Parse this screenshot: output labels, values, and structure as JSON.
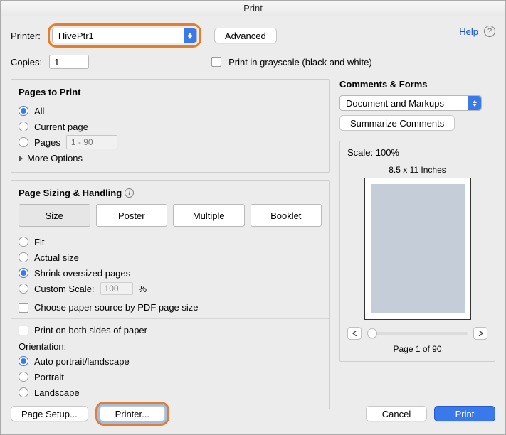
{
  "window": {
    "title": "Print"
  },
  "top": {
    "printer_label": "Printer:",
    "printer_value": "HivePtr1",
    "advanced": "Advanced",
    "help": "Help",
    "copies_label": "Copies:",
    "copies_value": "1",
    "grayscale_label": "Print in grayscale (black and white)"
  },
  "pages": {
    "group_title": "Pages to Print",
    "all": "All",
    "current": "Current page",
    "pages_label": "Pages",
    "pages_placeholder": "1 - 90",
    "more_options": "More Options"
  },
  "sizing": {
    "group_title": "Page Sizing & Handling",
    "seg_size": "Size",
    "seg_poster": "Poster",
    "seg_multiple": "Multiple",
    "seg_booklet": "Booklet",
    "fit": "Fit",
    "actual": "Actual size",
    "shrink": "Shrink oversized pages",
    "custom_scale": "Custom Scale:",
    "custom_scale_value": "100",
    "percent": "%",
    "choose_paper": "Choose paper source by PDF page size",
    "duplex": "Print on both sides of paper",
    "orientation_label": "Orientation:",
    "orient_auto": "Auto portrait/landscape",
    "orient_portrait": "Portrait",
    "orient_landscape": "Landscape"
  },
  "comments": {
    "group_title": "Comments & Forms",
    "select_value": "Document and Markups",
    "summarize": "Summarize Comments"
  },
  "preview": {
    "scale_label": "Scale: 100%",
    "dimensions": "8.5 x 11 Inches",
    "page_indicator": "Page 1 of 90"
  },
  "bottom": {
    "page_setup": "Page Setup...",
    "printer_btn": "Printer...",
    "cancel": "Cancel",
    "print": "Print"
  }
}
